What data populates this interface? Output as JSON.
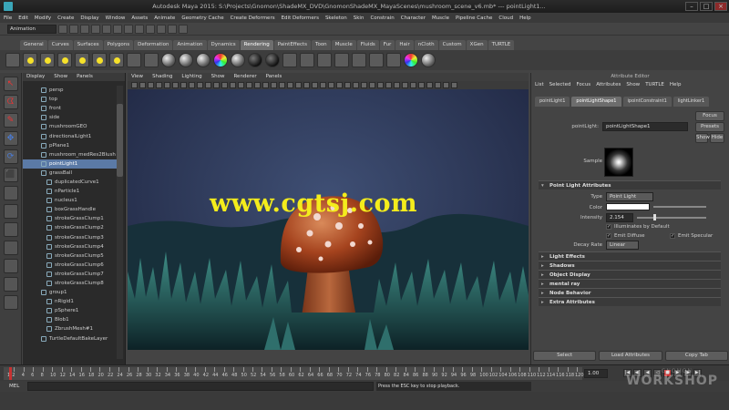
{
  "window": {
    "title": "Autodesk Maya 2015: S:\\Projects\\Gnomon\\ShadeMX_DVD\\GnomonShadeMX_MayaScenes\\mushroom_scene_v6.mb* --- pointLight1..."
  },
  "menubar": [
    "File",
    "Edit",
    "Modify",
    "Create",
    "Display",
    "Window",
    "Assets",
    "Animate",
    "Geometry Cache",
    "Create Deformers",
    "Edit Deformers",
    "Skeleton",
    "Skin",
    "Constrain",
    "Character",
    "Muscle",
    "Pipeline Cache",
    "Cloud",
    "Help"
  ],
  "statusline": {
    "mode": "Animation"
  },
  "shelf_tabs": {
    "items": [
      "General",
      "Curves",
      "Surfaces",
      "Polygons",
      "Deformation",
      "Animation",
      "Dynamics",
      "Rendering",
      "PaintEffects",
      "Toon",
      "Muscle",
      "Fluids",
      "Fur",
      "Hair",
      "nCloth",
      "Custom",
      "XGen",
      "TURTLE"
    ],
    "active": 7
  },
  "outliner": {
    "menu": [
      "Display",
      "Show",
      "Panels"
    ],
    "items": [
      "persp",
      "top",
      "front",
      "side",
      "mushroomGEO",
      "directionalLight1",
      "pPlane1",
      "mushroom_medRes2Blush",
      "pointLight1",
      "grassBall",
      "duplicatedCurve1",
      "nParticle1",
      "nucleus1",
      "boxGrassHandle",
      "strokeGrassClump1",
      "strokeGrassClump2",
      "strokeGrassClump3",
      "strokeGrassClump4",
      "strokeGrassClump5",
      "strokeGrassClump6",
      "strokeGrassClump7",
      "strokeGrassClump8",
      "group1",
      "nRigid1",
      "pSphere1",
      "Blob1",
      "ZbrushMesh#1",
      "TurtleDefaultBakeLayer"
    ],
    "selected": 8
  },
  "viewport": {
    "menu": [
      "View",
      "Shading",
      "Lighting",
      "Show",
      "Renderer",
      "Panels"
    ],
    "watermark": "www.cgtsj.com"
  },
  "attribute_editor": {
    "header": "Attribute Editor",
    "menu": [
      "List",
      "Selected",
      "Focus",
      "Attributes",
      "Show",
      "TURTLE",
      "Help"
    ],
    "tabs": [
      "pointLight1",
      "pointLightShape1",
      "ipointConstraint1",
      "lightLinker1"
    ],
    "active_tab": 1,
    "node_label": "pointLight:",
    "node_value": "pointLightShape1",
    "focus_button": "Focus",
    "presets_button": "Presets",
    "show_button": "Show",
    "hide_button": "Hide",
    "sample_label": "Sample",
    "sections": {
      "point_light": "Point Light Attributes",
      "light_effects": "Light Effects",
      "shadows": "Shadows",
      "object_display": "Object Display",
      "mental_ray": "mental ray",
      "node_behavior": "Node Behavior",
      "extra": "Extra Attributes"
    },
    "type_label": "Type",
    "type_value": "Point Light",
    "color_label": "Color",
    "intensity_label": "Intensity",
    "intensity_value": "2.154",
    "illuminates_label": "Illuminates by Default",
    "emit_diffuse_label": "Emit Diffuse",
    "emit_specular_label": "Emit Specular",
    "decay_label": "Decay Rate",
    "decay_value": "Linear",
    "select_button": "Select",
    "load_button": "Load Attributes",
    "copy_button": "Copy Tab"
  },
  "timeline": {
    "ticks": [
      1,
      2,
      4,
      6,
      8,
      10,
      12,
      14,
      16,
      18,
      20,
      22,
      24,
      26,
      28,
      30,
      32,
      34,
      36,
      38,
      40,
      42,
      44,
      46,
      48,
      50,
      52,
      54,
      56,
      58,
      60,
      62,
      64,
      66,
      68,
      70,
      72,
      74,
      76,
      78,
      80,
      82,
      84,
      86,
      88,
      90,
      92,
      94,
      96,
      98,
      100,
      102,
      104,
      106,
      108,
      110,
      112,
      114,
      116,
      118,
      120
    ],
    "current_frame": "1.00"
  },
  "cmdline": {
    "label": "MEL",
    "help": "Press the ESC key to stop playback."
  },
  "branding": {
    "top": "GNOMON",
    "main": "WORKSHOP"
  },
  "colors": {
    "selection": "#5b7aa6",
    "watermark": "#f4ec1c",
    "viewport_bg": "#2d3857"
  }
}
